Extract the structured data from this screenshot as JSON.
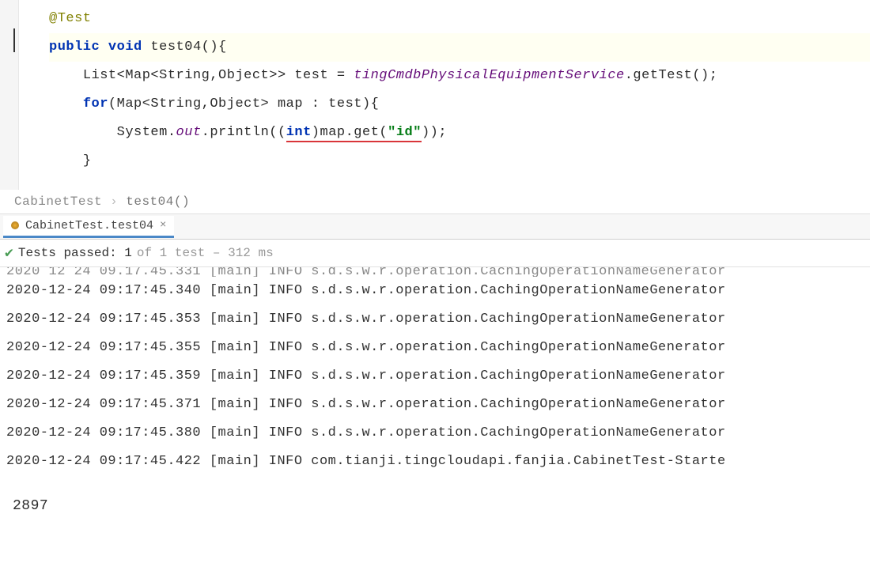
{
  "code": {
    "annotation": "@Test",
    "sig_public": "public",
    "sig_void": "void",
    "sig_name": " test04(){",
    "line3_a": "List<Map<String,Object>> test = ",
    "line3_b": "tingCmdbPhysicalEquipmentService",
    "line3_c": ".getTest();",
    "line4_for": "for",
    "line4_rest": "(Map<String,Object> map : test){",
    "line5_a": "System.",
    "line5_out": "out",
    "line5_b": ".println((",
    "line5_int": "int",
    "line5_c": ")map.get(",
    "line5_str": "\"id\"",
    "line5_d": "));",
    "line6": "}"
  },
  "breadcrumb": {
    "class": "CabinetTest",
    "method": "test04()"
  },
  "runtab": {
    "label": "CabinetTest.test04",
    "close": "×"
  },
  "teststatus": {
    "passed_label": "Tests passed: 1",
    "detail": " of 1 test – 312 ms"
  },
  "console": [
    {
      "ts": "2020-12-24 09:17:45.340",
      "thread": "[main]",
      "level": "INFO",
      "msg": "s.d.s.w.r.operation.CachingOperationNameGenerator"
    },
    {
      "ts": "2020-12-24 09:17:45.353",
      "thread": "[main]",
      "level": "INFO",
      "msg": "s.d.s.w.r.operation.CachingOperationNameGenerator"
    },
    {
      "ts": "2020-12-24 09:17:45.355",
      "thread": "[main]",
      "level": "INFO",
      "msg": "s.d.s.w.r.operation.CachingOperationNameGenerator"
    },
    {
      "ts": "2020-12-24 09:17:45.359",
      "thread": "[main]",
      "level": "INFO",
      "msg": "s.d.s.w.r.operation.CachingOperationNameGenerator"
    },
    {
      "ts": "2020-12-24 09:17:45.371",
      "thread": "[main]",
      "level": "INFO",
      "msg": "s.d.s.w.r.operation.CachingOperationNameGenerator"
    },
    {
      "ts": "2020-12-24 09:17:45.380",
      "thread": "[main]",
      "level": "INFO",
      "msg": "s.d.s.w.r.operation.CachingOperationNameGenerator"
    },
    {
      "ts": "2020-12-24 09:17:45.422",
      "thread": "[main]",
      "level": "INFO",
      "msg": "com.tianji.tingcloudapi.fanjia.CabinetTest-Starte"
    }
  ],
  "output_value": "2897"
}
